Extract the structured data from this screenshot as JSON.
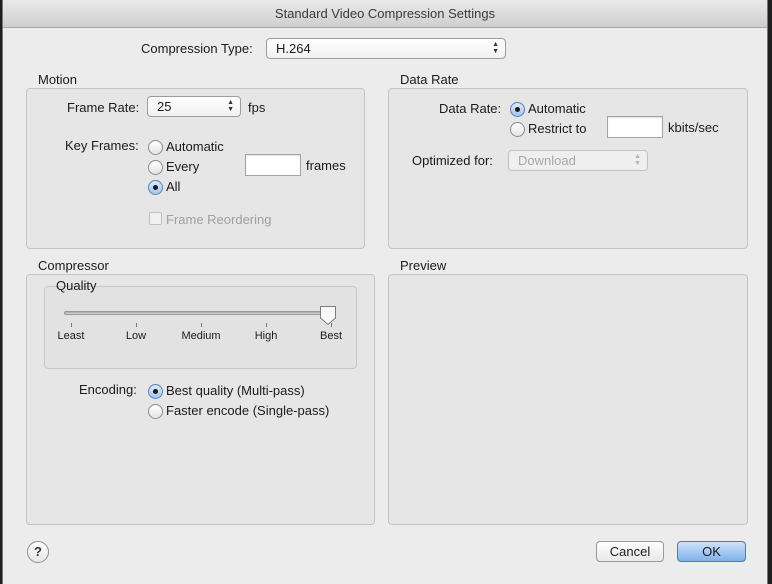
{
  "window": {
    "title": "Standard Video Compression Settings"
  },
  "compression_type": {
    "label": "Compression Type:",
    "value": "H.264"
  },
  "motion": {
    "title": "Motion",
    "frame_rate_label": "Frame Rate:",
    "frame_rate_value": "25",
    "frame_rate_unit": "fps",
    "key_frames_label": "Key Frames:",
    "key_frames_options": [
      "Automatic",
      "Every",
      "All"
    ],
    "key_frames_selected": "All",
    "frames_unit": "frames",
    "frame_reordering_label": "Frame Reordering"
  },
  "data_rate": {
    "title": "Data Rate",
    "label": "Data Rate:",
    "options": [
      "Automatic",
      "Restrict to"
    ],
    "selected": "Automatic",
    "unit": "kbits/sec",
    "optimized_label": "Optimized for:",
    "optimized_value": "Download"
  },
  "compressor": {
    "title": "Compressor",
    "quality_title": "Quality",
    "quality_ticks": [
      "Least",
      "Low",
      "Medium",
      "High",
      "Best"
    ],
    "quality_selected": "Best",
    "encoding_label": "Encoding:",
    "encoding_options": [
      "Best quality (Multi-pass)",
      "Faster encode (Single-pass)"
    ],
    "encoding_selected": "Best quality (Multi-pass)"
  },
  "preview": {
    "title": "Preview"
  },
  "footer": {
    "help_label": "?",
    "cancel_label": "Cancel",
    "ok_label": "OK"
  },
  "colors": {
    "accent": "#7fb1ec",
    "window_bg": "#ececec",
    "backdrop": "#1e1e1e"
  },
  "icons": {
    "help": "question-mark-icon",
    "popup_arrows": "up-down-arrows-icon"
  }
}
